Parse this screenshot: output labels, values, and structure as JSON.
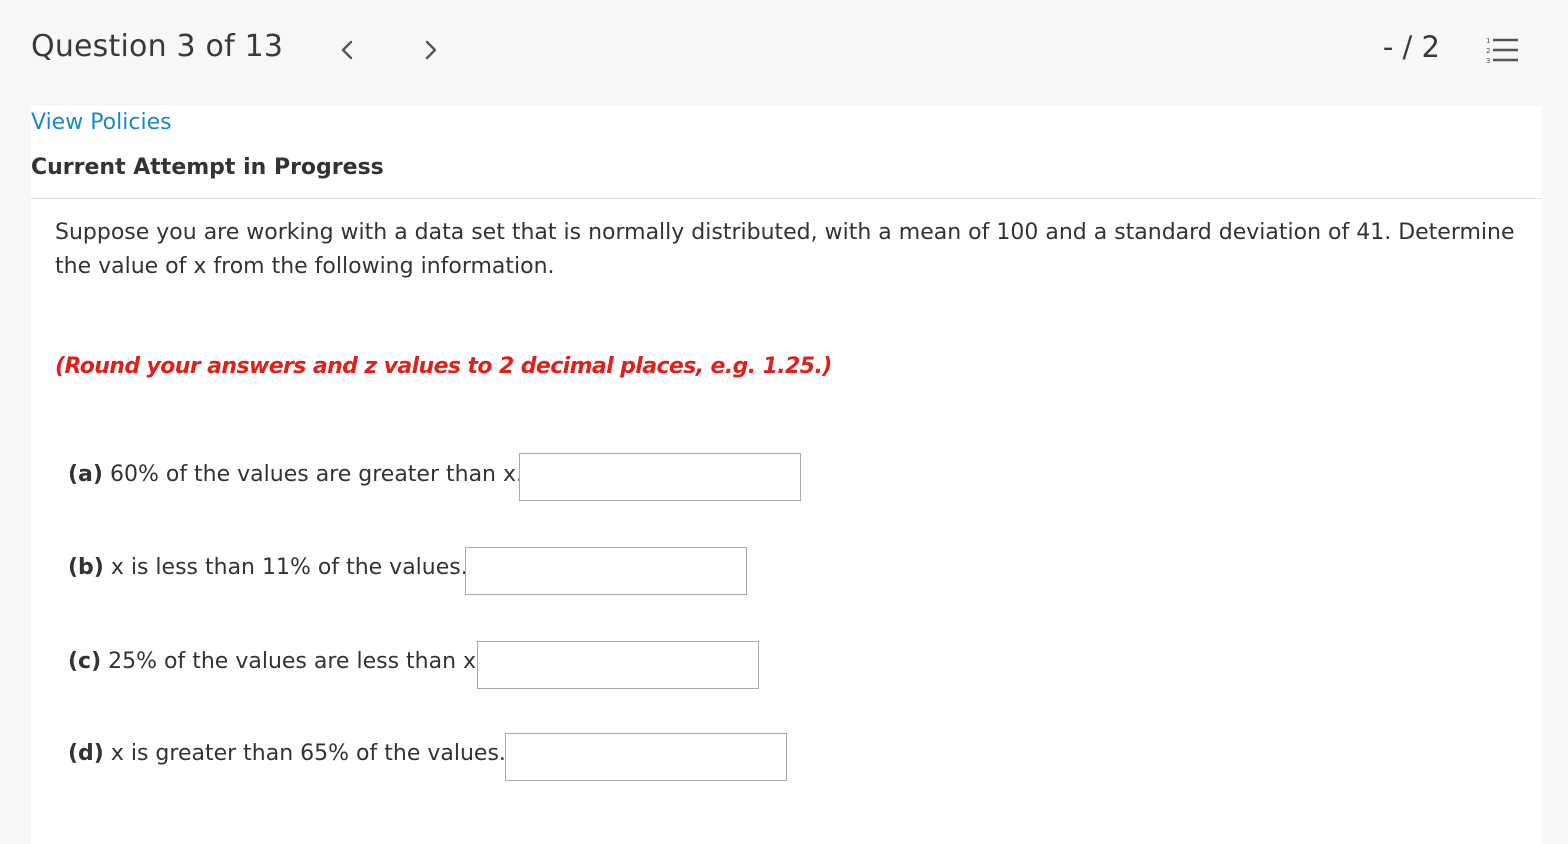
{
  "header": {
    "question_counter": "Question 3 of 13",
    "prev_symbol": "<",
    "next_symbol": ">",
    "score": "- / 2"
  },
  "links": {
    "view_policies": "View Policies"
  },
  "status": {
    "attempt": "Current Attempt in Progress"
  },
  "question": {
    "text": "Suppose you are working with a data set that is normally distributed, with a mean of 100 and a standard deviation of 41. Determine the value of x from the following information.",
    "note": "(Round your answers and z values to 2 decimal places, e.g. 1.25.)"
  },
  "parts": [
    {
      "tag": "(a)",
      "text": " 60% of the values are greater than x.",
      "value": ""
    },
    {
      "tag": "(b)",
      "text": " x is less than 11% of the values.",
      "value": ""
    },
    {
      "tag": "(c)",
      "text": " 25% of the values are less than x.",
      "value": ""
    },
    {
      "tag": "(d)",
      "text": " x is greater than 65% of the values.",
      "value": ""
    }
  ],
  "colors": {
    "link": "#1a87c9",
    "note": "#e0201c",
    "header_bg": "#f7f7f7",
    "panel_bg": "#ffffff"
  }
}
